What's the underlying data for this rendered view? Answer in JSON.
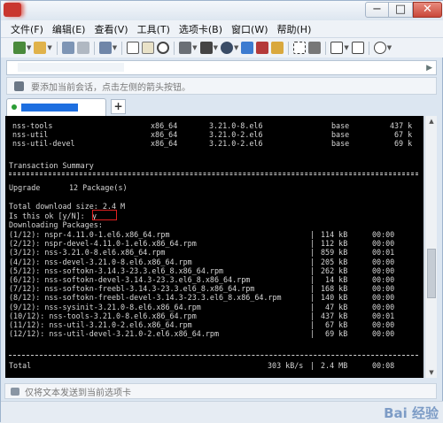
{
  "window": {
    "controls": [
      "−",
      "□",
      "✕"
    ]
  },
  "menu": [
    "文件(F)",
    "编辑(E)",
    "查看(V)",
    "工具(T)",
    "选项卡(B)",
    "窗口(W)",
    "帮助(H)"
  ],
  "toolbar_icons": [
    "new-session-icon",
    "open-folder-icon",
    "pencil-icon",
    "disconnect-icon",
    "properties-icon",
    "copy-icon",
    "paste-icon",
    "find-icon",
    "print-icon",
    "color-scheme-icon",
    "globe-icon",
    "transfer-icon",
    "xftp-icon",
    "lock-icon",
    "fullscreen-icon",
    "keyboard-icon",
    "new-tab-icon",
    "layout-icon",
    "help-icon"
  ],
  "hint": {
    "text": "要添加当前会话，点击左侧的箭头按钮。"
  },
  "tabs": {
    "add_label": "+"
  },
  "terminal": {
    "top_packages": [
      {
        "name": "nss-tools",
        "arch": "x86_64",
        "version": "3.21.0-8.el6",
        "repo": "base",
        "size": "437 k"
      },
      {
        "name": "nss-util",
        "arch": "x86_64",
        "version": "3.21.0-2.el6",
        "repo": "base",
        "size": "67 k"
      },
      {
        "name": "nss-util-devel",
        "arch": "x86_64",
        "version": "3.21.0-2.el6",
        "repo": "base",
        "size": "69 k"
      }
    ],
    "summary_title": "Transaction Summary",
    "upgrade": {
      "label": "Upgrade",
      "value": "12 Package(s)"
    },
    "total_download": "Total download size: 2.4 M",
    "prompt": "Is this ok [y/N]:",
    "answer": "y",
    "downloading": "Downloading Packages:",
    "downloads": [
      {
        "file": "(1/12): nspr-4.11.0-1.el6.x86_64.rpm",
        "size": "114 kB",
        "time": "00:00"
      },
      {
        "file": "(2/12): nspr-devel-4.11.0-1.el6.x86_64.rpm",
        "size": "112 kB",
        "time": "00:00"
      },
      {
        "file": "(3/12): nss-3.21.0-8.el6.x86_64.rpm",
        "size": "859 kB",
        "time": "00:01"
      },
      {
        "file": "(4/12): nss-devel-3.21.0-8.el6.x86_64.rpm",
        "size": "205 kB",
        "time": "00:00"
      },
      {
        "file": "(5/12): nss-softokn-3.14.3-23.3.el6_8.x86_64.rpm",
        "size": "262 kB",
        "time": "00:00"
      },
      {
        "file": "(6/12): nss-softokn-devel-3.14.3-23.3.el6_8.x86_64.rpm",
        "size": " 14 kB",
        "time": "00:00"
      },
      {
        "file": "(7/12): nss-softokn-freebl-3.14.3-23.3.el6_8.x86_64.rpm",
        "size": "168 kB",
        "time": "00:00"
      },
      {
        "file": "(8/12): nss-softokn-freebl-devel-3.14.3-23.3.el6_8.x86_64.rpm",
        "size": "140 kB",
        "time": "00:00"
      },
      {
        "file": "(9/12): nss-sysinit-3.21.0-8.el6.x86_64.rpm",
        "size": " 47 kB",
        "time": "00:00"
      },
      {
        "file": "(10/12): nss-tools-3.21.0-8.el6.x86_64.rpm",
        "size": "437 kB",
        "time": "00:01"
      },
      {
        "file": "(11/12): nss-util-3.21.0-2.el6.x86_64.rpm",
        "size": " 67 kB",
        "time": "00:00"
      },
      {
        "file": "(12/12): nss-util-devel-3.21.0-2.el6.x86_64.rpm",
        "size": " 69 kB",
        "time": "00:00"
      }
    ],
    "total": {
      "label": "Total",
      "rate": "303 kB/s",
      "size": "2.4 MB",
      "time": "00:08"
    }
  },
  "composer": {
    "placeholder": "仅将文本发送到当前选项卡"
  },
  "watermark": "Bai 经验"
}
